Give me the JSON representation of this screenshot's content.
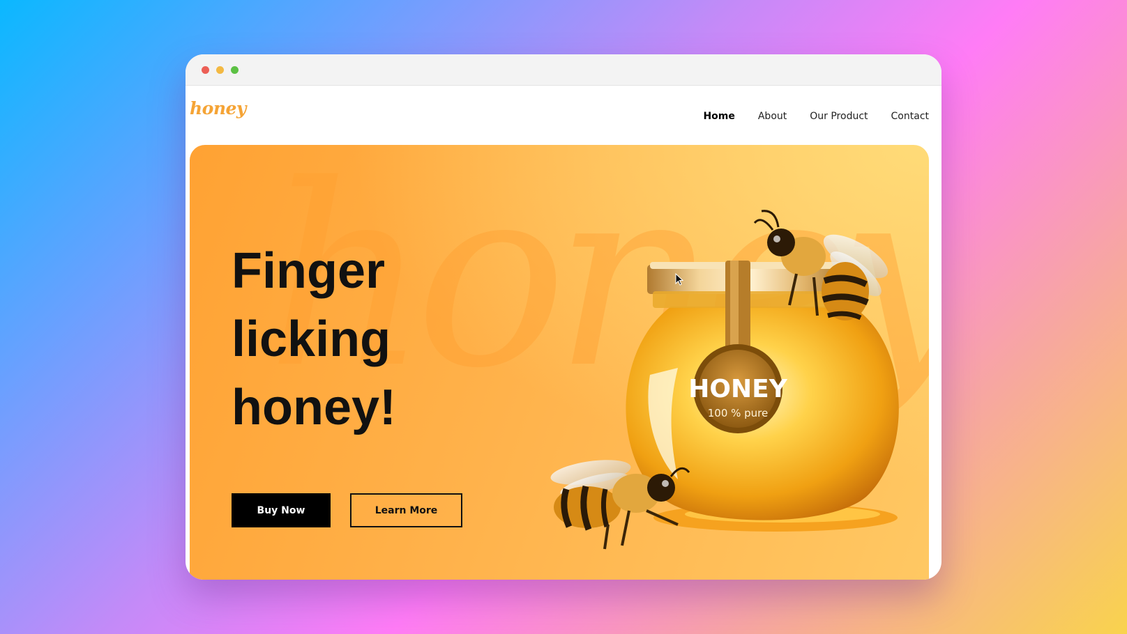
{
  "window": {
    "controls": [
      "close",
      "minimize",
      "maximize"
    ]
  },
  "navbar": {
    "logo": "honey",
    "links": [
      {
        "label": "Home",
        "active": true
      },
      {
        "label": "About",
        "active": false
      },
      {
        "label": "Our Product",
        "active": false
      },
      {
        "label": "Contact",
        "active": false
      }
    ]
  },
  "hero": {
    "watermark": "honey",
    "headline": [
      "Finger",
      "licking",
      "honey!"
    ],
    "buy_label": "Buy Now",
    "learn_label": "Learn More",
    "jar_label": "HONEY",
    "jar_sublabel": "100 % pure"
  },
  "colors": {
    "accent": "#f5a436",
    "hero_orange": "#ffa233",
    "button_dark": "#000000"
  },
  "icons": [
    "close-dot",
    "minimize-dot",
    "maximize-dot",
    "bee-icon",
    "honey-jar-icon",
    "cursor-icon"
  ]
}
